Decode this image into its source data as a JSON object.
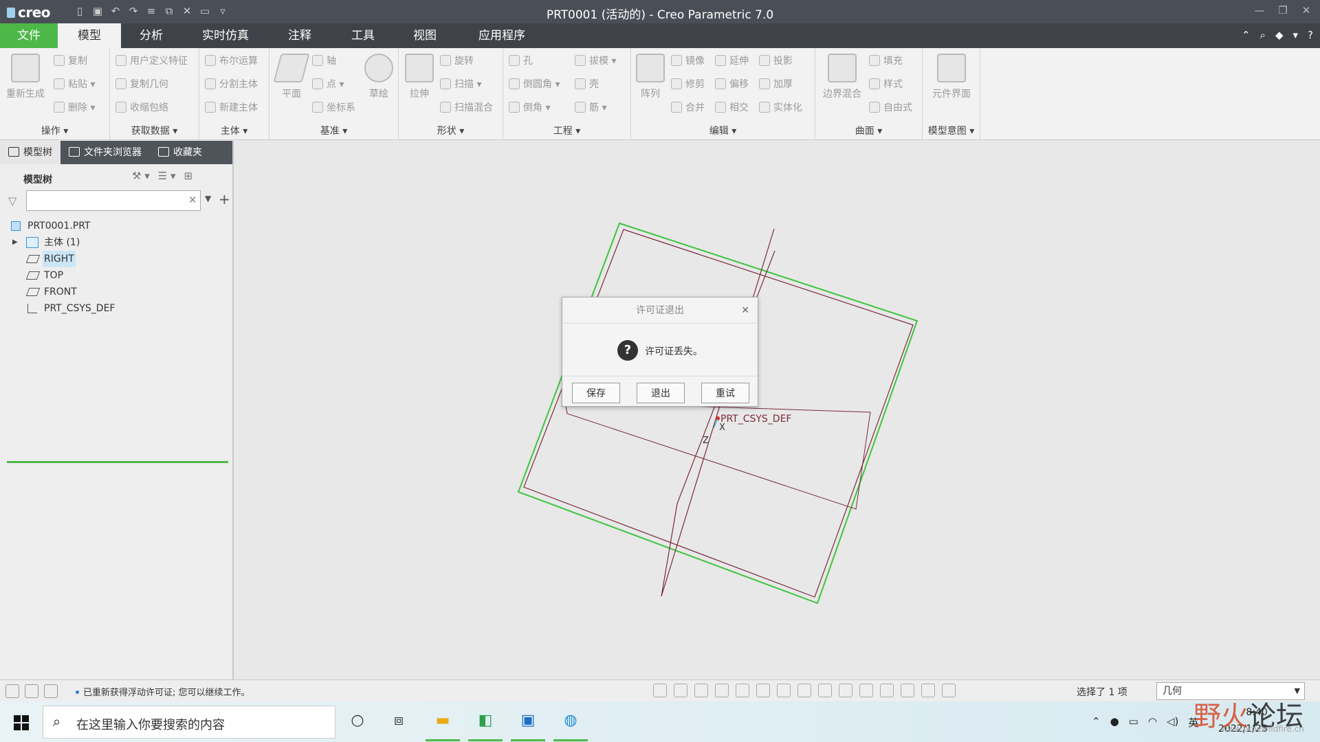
{
  "window": {
    "logo": "creo",
    "title": "PRT0001 (活动的) - Creo Parametric 7.0"
  },
  "tabs": [
    "文件",
    "模型",
    "分析",
    "实时仿真",
    "注释",
    "工具",
    "视图",
    "应用程序"
  ],
  "ribbon": {
    "groups": {
      "operations": "操作",
      "get_data": "获取数据",
      "body": "主体",
      "datum": "基准",
      "shapes": "形状",
      "engineering": "工程",
      "editing": "编辑",
      "surfaces": "曲面",
      "model_intent": "模型意图"
    },
    "buttons": {
      "regenerate": "重新生成",
      "copy": "复制",
      "paste": "粘贴",
      "delete": "删除",
      "udf": "用户定义特征",
      "copy_geom": "复制几何",
      "shrinkwrap": "收缩包络",
      "boolean": "布尔运算",
      "split_body": "分割主体",
      "new_body": "新建主体",
      "plane": "平面",
      "axis": "轴",
      "point": "点",
      "csys": "坐标系",
      "sketch": "草绘",
      "extrude": "拉伸",
      "revolve": "旋转",
      "sweep": "扫描",
      "swept_blend": "扫描混合",
      "hole": "孔",
      "round": "倒圆角",
      "chamfer": "倒角",
      "draft": "拔模",
      "shell": "壳",
      "rib": "筋",
      "pattern": "阵列",
      "mirror": "镜像",
      "trim": "修剪",
      "merge": "合并",
      "extend": "延伸",
      "offset": "偏移",
      "intersect": "相交",
      "project": "投影",
      "thicken": "加厚",
      "solidify": "实体化",
      "boundary_blend": "边界混合",
      "fill": "填充",
      "style": "样式",
      "freestyle": "自由式",
      "component_interface": "元件界面"
    }
  },
  "left_panel": {
    "tabs": [
      "模型树",
      "文件夹浏览器",
      "收藏夹"
    ],
    "tree_title": "模型树",
    "filter_value": "",
    "nodes": [
      {
        "label": "PRT0001.PRT"
      },
      {
        "label": "主体 (1)"
      },
      {
        "label": "RIGHT"
      },
      {
        "label": "TOP"
      },
      {
        "label": "FRONT"
      },
      {
        "label": "PRT_CSYS_DEF"
      }
    ]
  },
  "graphics": {
    "csys_label": "PRT_CSYS_DEF",
    "axis_x": "X",
    "axis_z": "Z"
  },
  "dialog": {
    "title": "许可证退出",
    "message": "许可证丢失。",
    "buttons": [
      "保存",
      "退出",
      "重试"
    ]
  },
  "status": {
    "message": "已重新获得浮动许可证; 您可以继续工作。",
    "selection": "选择了 1 项",
    "filter": "几何"
  },
  "taskbar": {
    "search_placeholder": "在这里输入你要搜索的内容",
    "ime": "英",
    "time": "8:40",
    "date": "2022/1/23"
  },
  "watermark": {
    "brand": "野火",
    "brand2": "论坛",
    "url": "www.proewildfire.cn"
  },
  "colors": {
    "accent_green": "#4db848",
    "tab_bar": "#3f4349",
    "title_bar": "#4a4f57",
    "datum_plane": "#7a2a3a"
  }
}
